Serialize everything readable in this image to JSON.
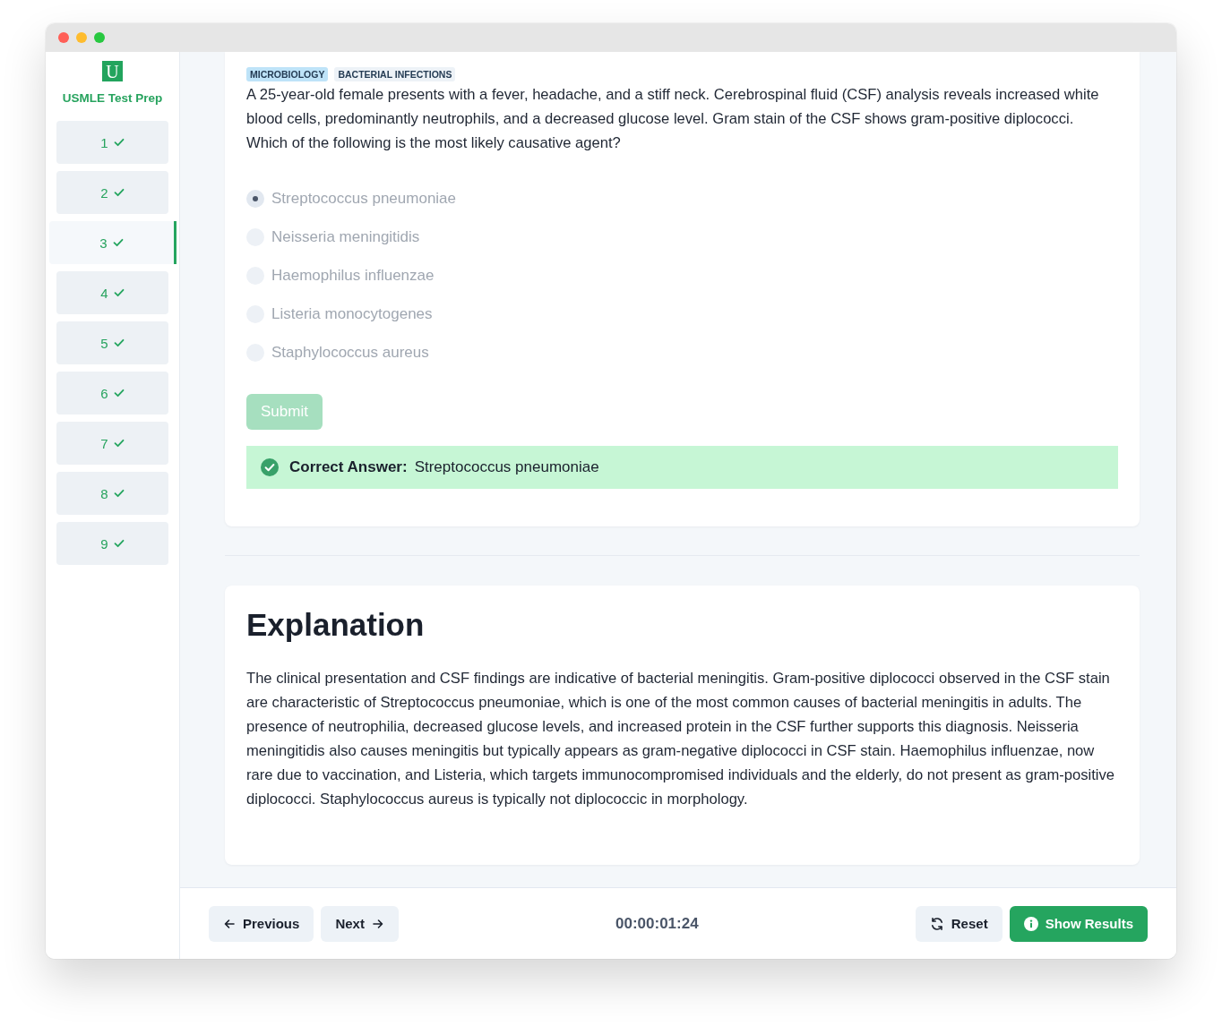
{
  "sidebar": {
    "logo": "U",
    "title": "USMLE Test Prep",
    "items": [
      {
        "label": "1",
        "answered": true,
        "selected": false
      },
      {
        "label": "2",
        "answered": true,
        "selected": false
      },
      {
        "label": "3",
        "answered": true,
        "selected": true
      },
      {
        "label": "4",
        "answered": true,
        "selected": false
      },
      {
        "label": "5",
        "answered": true,
        "selected": false
      },
      {
        "label": "6",
        "answered": true,
        "selected": false
      },
      {
        "label": "7",
        "answered": true,
        "selected": false
      },
      {
        "label": "8",
        "answered": true,
        "selected": false
      },
      {
        "label": "9",
        "answered": true,
        "selected": false
      }
    ]
  },
  "question": {
    "tags": [
      {
        "label": "MICROBIOLOGY",
        "color": "#bee3f8"
      },
      {
        "label": "BACTERIAL INFECTIONS",
        "color": "#edf2f7"
      }
    ],
    "text": "A 25-year-old female presents with a fever, headache, and a stiff neck. Cerebrospinal fluid (CSF) analysis reveals increased white blood cells, predominantly neutrophils, and a decreased glucose level. Gram stain of the CSF shows gram-positive diplococci. Which of the following is the most likely causative agent?",
    "options": [
      {
        "label": "Streptococcus pneumoniae",
        "selected": true,
        "disabled": true
      },
      {
        "label": "Neisseria meningitidis",
        "selected": false,
        "disabled": true
      },
      {
        "label": "Haemophilus influenzae",
        "selected": false,
        "disabled": true
      },
      {
        "label": "Listeria monocytogenes",
        "selected": false,
        "disabled": true
      },
      {
        "label": "Staphylococcus aureus",
        "selected": false,
        "disabled": true
      }
    ],
    "submit": {
      "label": "Submit",
      "disabled": true
    },
    "result": {
      "correct": true,
      "label": "Correct Answer:",
      "answer": "Streptococcus pneumoniae"
    }
  },
  "explanation": {
    "title": "Explanation",
    "text": "The clinical presentation and CSF findings are indicative of bacterial meningitis. Gram-positive diplococci observed in the CSF stain are characteristic of Streptococcus pneumoniae, which is one of the most common causes of bacterial meningitis in adults. The presence of neutrophilia, decreased glucose levels, and increased protein in the CSF further supports this diagnosis. Neisseria meningitidis also causes meningitis but typically appears as gram-negative diplococci in CSF stain. Haemophilus influenzae, now rare due to vaccination, and Listeria, which targets immunocompromised individuals and the elderly, do not present as gram-positive diplococci. Staphylococcus aureus is typically not diplococcic in morphology."
  },
  "footer": {
    "previous": "Previous",
    "next": "Next",
    "timer": "00:00:01:24",
    "reset": "Reset",
    "show_results": "Show Results"
  }
}
